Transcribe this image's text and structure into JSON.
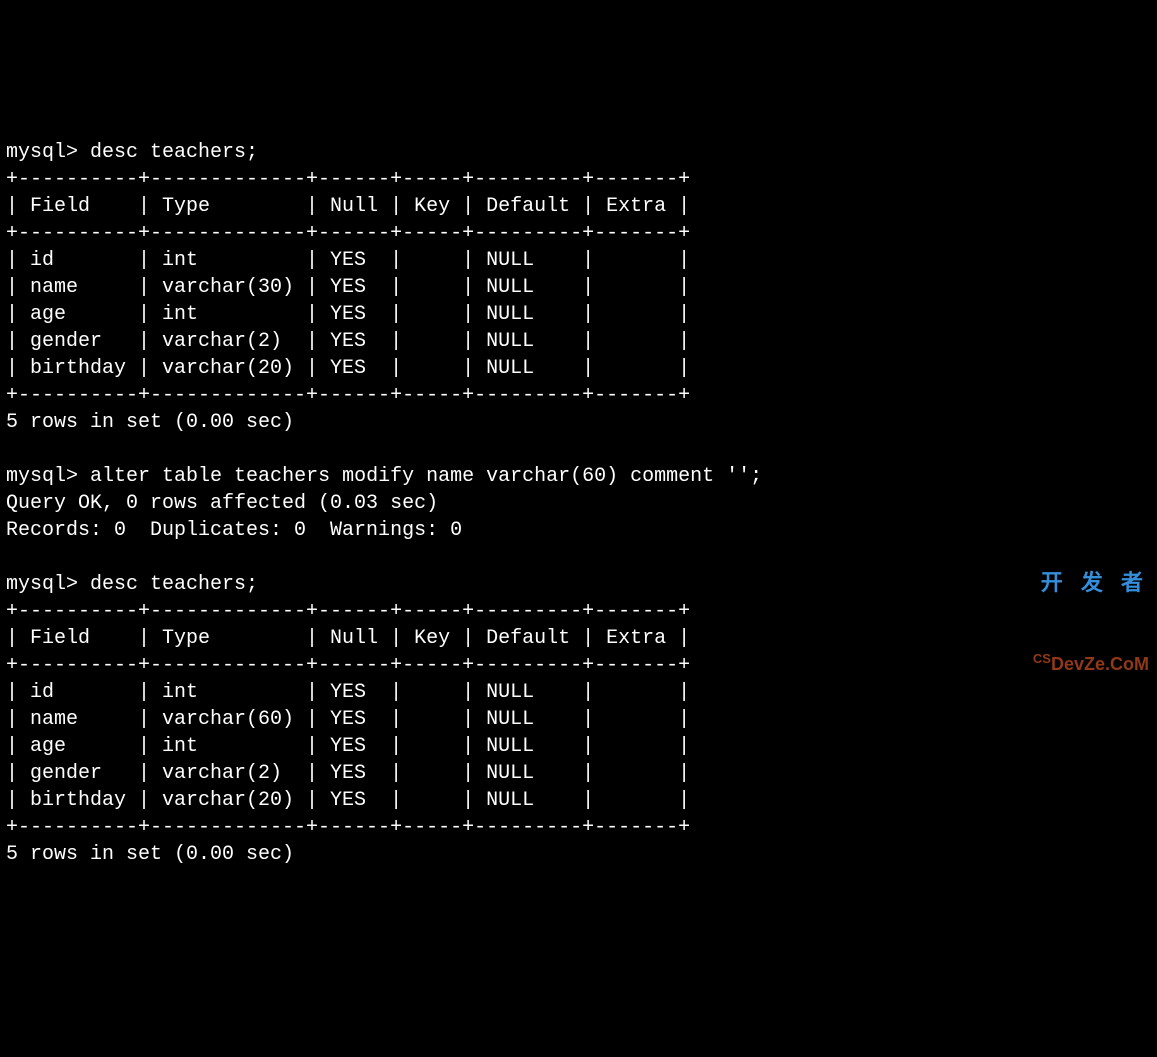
{
  "prompt": "mysql>",
  "cmd1": "desc teachers;",
  "border": "+----------+-------------+------+-----+---------+-------+",
  "header": "| Field    | Type        | Null | Key | Default | Extra |",
  "table1": {
    "rows": [
      "| id       | int         | YES  |     | NULL    |       |",
      "| name     | varchar(30) | YES  |     | NULL    |       |",
      "| age      | int         | YES  |     | NULL    |       |",
      "| gender   | varchar(2)  | YES  |     | NULL    |       |",
      "| birthday | varchar(20) | YES  |     | NULL    |       |"
    ]
  },
  "footer1": "5 rows in set (0.00 sec)",
  "cmd2": "alter table teachers modify name varchar(60) comment '';",
  "result2a": "Query OK, 0 rows affected (0.03 sec)",
  "result2b": "Records: 0  Duplicates: 0  Warnings: 0",
  "cmd3": "desc teachers;",
  "table2": {
    "rows": [
      "| id       | int         | YES  |     | NULL    |       |",
      "| name     | varchar(60) | YES  |     | NULL    |       |",
      "| age      | int         | YES  |     | NULL    |       |",
      "| gender   | varchar(2)  | YES  |     | NULL    |       |",
      "| birthday | varchar(20) | YES  |     | NULL    |       |"
    ]
  },
  "footer2": "5 rows in set (0.00 sec)",
  "watermark": {
    "cn": "开 发 者",
    "en": "DevZe.CoM",
    "prefix": "CS"
  },
  "chart_data": {
    "type": "table",
    "title": "desc teachers",
    "columns": [
      "Field",
      "Type",
      "Null",
      "Key",
      "Default",
      "Extra"
    ],
    "before": [
      {
        "Field": "id",
        "Type": "int",
        "Null": "YES",
        "Key": "",
        "Default": "NULL",
        "Extra": ""
      },
      {
        "Field": "name",
        "Type": "varchar(30)",
        "Null": "YES",
        "Key": "",
        "Default": "NULL",
        "Extra": ""
      },
      {
        "Field": "age",
        "Type": "int",
        "Null": "YES",
        "Key": "",
        "Default": "NULL",
        "Extra": ""
      },
      {
        "Field": "gender",
        "Type": "varchar(2)",
        "Null": "YES",
        "Key": "",
        "Default": "NULL",
        "Extra": ""
      },
      {
        "Field": "birthday",
        "Type": "varchar(20)",
        "Null": "YES",
        "Key": "",
        "Default": "NULL",
        "Extra": ""
      }
    ],
    "after": [
      {
        "Field": "id",
        "Type": "int",
        "Null": "YES",
        "Key": "",
        "Default": "NULL",
        "Extra": ""
      },
      {
        "Field": "name",
        "Type": "varchar(60)",
        "Null": "YES",
        "Key": "",
        "Default": "NULL",
        "Extra": ""
      },
      {
        "Field": "age",
        "Type": "int",
        "Null": "YES",
        "Key": "",
        "Default": "NULL",
        "Extra": ""
      },
      {
        "Field": "gender",
        "Type": "varchar(2)",
        "Null": "YES",
        "Key": "",
        "Default": "NULL",
        "Extra": ""
      },
      {
        "Field": "birthday",
        "Type": "varchar(20)",
        "Null": "YES",
        "Key": "",
        "Default": "NULL",
        "Extra": ""
      }
    ],
    "alter_statement": "alter table teachers modify name varchar(60) comment '';",
    "alter_result": {
      "query": "OK",
      "rows_affected": 0,
      "time_sec": 0.03,
      "records": 0,
      "duplicates": 0,
      "warnings": 0
    }
  }
}
